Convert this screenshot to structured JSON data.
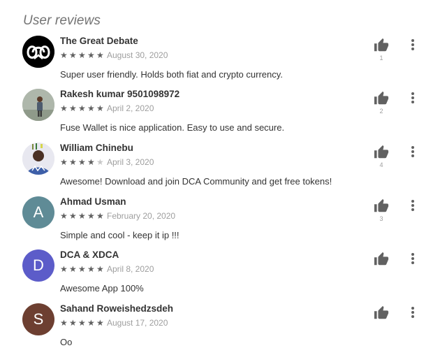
{
  "section_title": "User reviews",
  "reviews": [
    {
      "author": "The Great Debate",
      "rating": 5,
      "date": "August 30, 2020",
      "text": "Super user friendly. Holds both fiat and crypto currency.",
      "helpful_count": "1",
      "avatar": {
        "type": "logo",
        "color": "#000000"
      }
    },
    {
      "author": "Rakesh kumar 9501098972",
      "rating": 5,
      "date": "April 2, 2020",
      "text": "Fuse Wallet is nice application. Easy to use and secure.",
      "helpful_count": "2",
      "avatar": {
        "type": "photo",
        "color": "#b9c0b5"
      }
    },
    {
      "author": "William Chinebu",
      "rating": 4,
      "date": "April 3, 2020",
      "text": "Awesome! Download and join DCA Community and get free tokens!",
      "helpful_count": "4",
      "avatar": {
        "type": "photo",
        "color": "#e6e6ee"
      }
    },
    {
      "author": "Ahmad Usman",
      "rating": 5,
      "date": "February 20, 2020",
      "text": "Simple and cool - keep it ip !!!",
      "helpful_count": "3",
      "avatar": {
        "type": "letter",
        "letter": "A",
        "color": "#5f8b96"
      }
    },
    {
      "author": "DCA & XDCA",
      "rating": 5,
      "date": "April 8, 2020",
      "text": "Awesome App 100%",
      "helpful_count": "",
      "avatar": {
        "type": "letter",
        "letter": "D",
        "color": "#5c5cc9"
      }
    },
    {
      "author": "Sahand Roweishedzsdeh",
      "rating": 5,
      "date": "August 17, 2020",
      "text": "Oo",
      "helpful_count": "",
      "avatar": {
        "type": "letter",
        "letter": "S",
        "color": "#6d3f31"
      }
    }
  ],
  "colors": {
    "star_filled": "#616161",
    "star_empty": "#c8c8c8",
    "icon": "#616161"
  }
}
